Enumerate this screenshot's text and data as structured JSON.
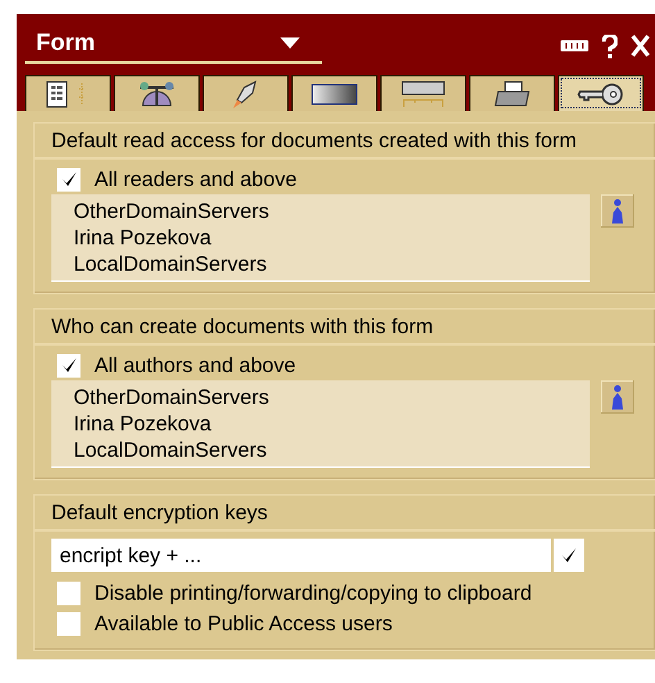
{
  "window": {
    "title": "Form"
  },
  "tabs": [
    {
      "kind": "info",
      "selected": false
    },
    {
      "kind": "scale",
      "selected": false
    },
    {
      "kind": "rocket",
      "selected": false
    },
    {
      "kind": "gradient",
      "selected": false
    },
    {
      "kind": "field",
      "selected": false
    },
    {
      "kind": "printer",
      "selected": false
    },
    {
      "kind": "key",
      "selected": true
    }
  ],
  "sections": [
    {
      "kind": "names",
      "title": "Default read access for documents created with this form",
      "option": {
        "label": "All readers and above",
        "checked": true
      },
      "names": [
        "OtherDomainServers",
        "Irina Pozekova",
        "LocalDomainServers"
      ]
    },
    {
      "kind": "names",
      "title": "Who can create documents with this form",
      "option": {
        "label": "All authors and above",
        "checked": true
      },
      "names": [
        "OtherDomainServers",
        "Irina Pozekova",
        "LocalDomainServers"
      ]
    },
    {
      "kind": "keys",
      "title": "Default encryption keys",
      "field": {
        "value": "encript key + ..."
      },
      "options": [
        {
          "label": "Disable printing/forwarding/copying to clipboard",
          "checked": false
        },
        {
          "label": "Available to Public Access users",
          "checked": false
        }
      ]
    }
  ]
}
